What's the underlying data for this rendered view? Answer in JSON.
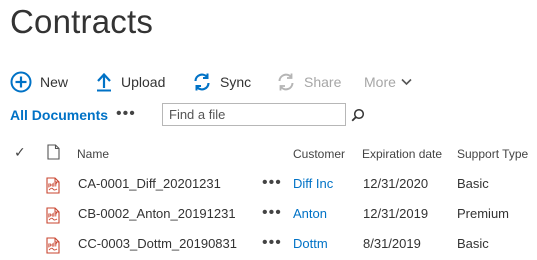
{
  "page": {
    "title": "Contracts"
  },
  "commands": {
    "new": "New",
    "upload": "Upload",
    "sync": "Sync",
    "share": "Share",
    "more": "More"
  },
  "view": {
    "name": "All Documents",
    "more_glyph": "•••"
  },
  "search": {
    "placeholder": "Find a file"
  },
  "columns": {
    "check": "✓",
    "name": "Name",
    "customer": "Customer",
    "expiration": "Expiration date",
    "support": "Support Type"
  },
  "rows": [
    {
      "name": "CA-0001_Diff_20201231",
      "customer": "Diff Inc",
      "expiration": "12/31/2020",
      "support": "Basic",
      "file_type": "pdf"
    },
    {
      "name": "CB-0002_Anton_20191231",
      "customer": "Anton",
      "expiration": "12/31/2019",
      "support": "Premium",
      "file_type": "pdf"
    },
    {
      "name": "CC-0003_Dottm_20190831",
      "customer": "Dottm",
      "expiration": "8/31/2019",
      "support": "Basic",
      "file_type": "pdf"
    }
  ],
  "row_more_glyph": "•••",
  "colors": {
    "accent": "#0072c6",
    "pdf_red": "#c8442f",
    "disabled": "#a6a6a6"
  },
  "icons": {
    "new": "plus-circle-icon",
    "upload": "upload-arrow-icon",
    "sync": "sync-icon",
    "share": "share-icon",
    "more": "chevron-down-icon",
    "search": "magnifier-icon",
    "file_column": "document-icon",
    "file_row": "pdf-file-icon"
  }
}
